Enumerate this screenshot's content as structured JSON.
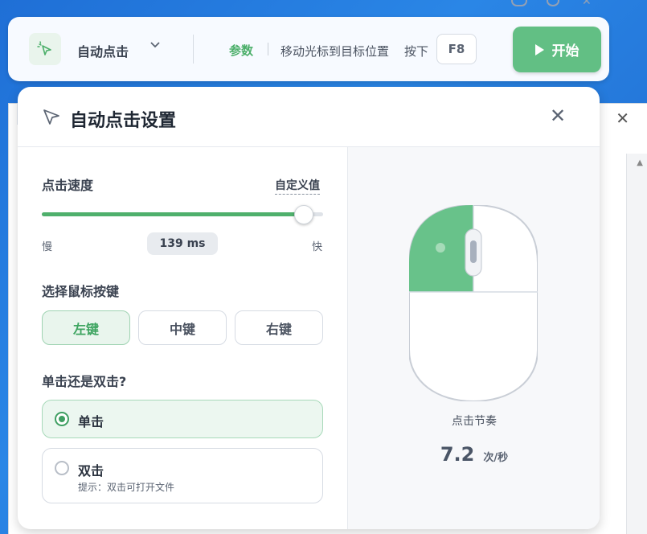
{
  "toolbar": {
    "mode_label": "自动点击",
    "param_label": "参数",
    "hint_text": "移动光标到目标位置",
    "press_label": "按下",
    "hotkey": "F8",
    "start_label": "开始"
  },
  "panel": {
    "title": "自动点击设置",
    "speed": {
      "title": "点击速度",
      "custom_link": "自定义值",
      "slow_label": "慢",
      "fast_label": "快",
      "value_text": "139 ms",
      "level": 0.93
    },
    "mouse_button": {
      "title": "选择鼠标按键",
      "options": [
        "左键",
        "中键",
        "右键"
      ],
      "selected": "左键"
    },
    "click_type": {
      "title": "单击还是双击?",
      "single_label": "单击",
      "double_label": "双击",
      "double_hint": "提示：双击可打开文件",
      "selected": "单击"
    },
    "preview": {
      "rhythm_label": "点击节奏",
      "rate_value": "7.2",
      "rate_unit": "次/秒"
    }
  },
  "colors": {
    "accent": "#62bf84",
    "accent_text": "#3da460"
  }
}
